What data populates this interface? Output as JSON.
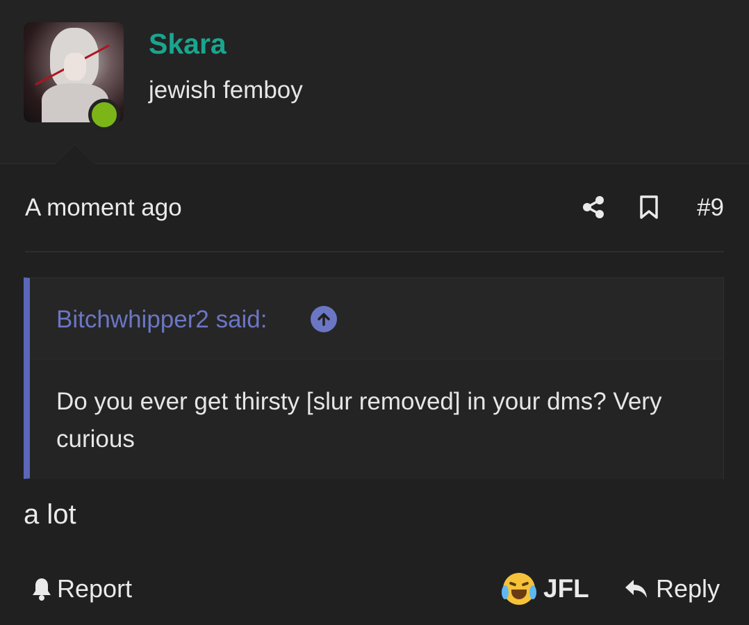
{
  "user": {
    "name": "Skara",
    "title": "jewish femboy",
    "online": true,
    "name_color": "#1aa58e",
    "online_color": "#7cb518"
  },
  "post": {
    "timestamp": "A moment ago",
    "number": "#9",
    "body": "a lot"
  },
  "quote": {
    "author_line": "Bitchwhipper2 said:",
    "text": "Do you ever get thirsty [slur removed] in your dms? Very curious",
    "accent_color": "#5b67b8"
  },
  "actions": {
    "report_label": "Report",
    "reaction_label": "JFL",
    "reaction_icon": "crying-laughing-emoji",
    "reply_label": "Reply"
  },
  "icons": {
    "share": "share-icon",
    "bookmark": "bookmark-icon",
    "quote_jump": "arrow-up-circle-icon",
    "report": "bell-icon",
    "reply": "reply-arrow-icon"
  }
}
